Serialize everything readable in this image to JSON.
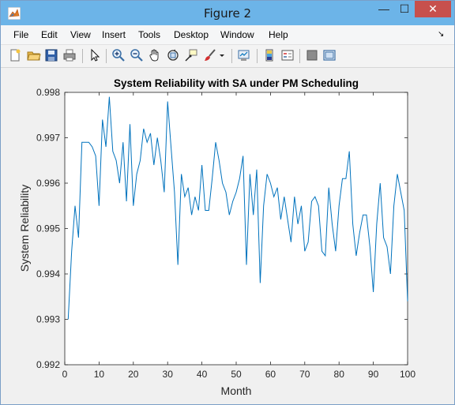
{
  "window": {
    "title": "Figure 2",
    "minimize_glyph": "—",
    "maximize_glyph": "☐",
    "close_glyph": "✕"
  },
  "menu": {
    "items": [
      "File",
      "Edit",
      "View",
      "Insert",
      "Tools",
      "Desktop",
      "Window",
      "Help"
    ]
  },
  "toolbar": {
    "icons": [
      "new-figure-icon",
      "open-file-icon",
      "save-icon",
      "print-icon",
      "edit-plot-arrow-icon",
      "zoom-in-icon",
      "zoom-out-icon",
      "pan-hand-icon",
      "rotate-3d-icon",
      "data-cursor-icon",
      "brush-icon",
      "brush-dropdown-icon",
      "link-plot-icon",
      "insert-colorbar-icon",
      "insert-legend-icon",
      "hide-plot-tools-icon",
      "show-plot-tools-icon"
    ]
  },
  "colors": {
    "line": "#0072bd",
    "close_button": "#c7504d",
    "titlebar": "#6cb4e8"
  },
  "chart_data": {
    "type": "line",
    "title": "System Reliability with SA under PM Scheduling",
    "xlabel": "Month",
    "ylabel": "System Reliability",
    "xlim": [
      0,
      100
    ],
    "ylim": [
      0.992,
      0.998
    ],
    "xticks": [
      0,
      10,
      20,
      30,
      40,
      50,
      60,
      70,
      80,
      90,
      100
    ],
    "yticks": [
      0.992,
      0.993,
      0.994,
      0.995,
      0.996,
      0.997,
      0.998
    ],
    "ytick_labels": [
      "0.992",
      "0.993",
      "0.994",
      "0.995",
      "0.996",
      "0.997",
      "0.998"
    ],
    "grid": false,
    "series": [
      {
        "x": [
          1,
          2,
          3,
          4,
          5,
          6,
          7,
          8,
          9,
          10,
          11,
          12,
          13,
          14,
          15,
          16,
          17,
          18,
          19,
          20,
          21,
          22,
          23,
          24,
          25,
          26,
          27,
          28,
          29,
          30,
          31,
          32,
          33,
          34,
          35,
          36,
          37,
          38,
          39,
          40,
          41,
          42,
          43,
          44,
          45,
          46,
          47,
          48,
          49,
          50,
          51,
          52,
          53,
          54,
          55,
          56,
          57,
          58,
          59,
          60,
          61,
          62,
          63,
          64,
          65,
          66,
          67,
          68,
          69,
          70,
          71,
          72,
          73,
          74,
          75,
          76,
          77,
          78,
          79,
          80,
          81,
          82,
          83,
          84,
          85,
          86,
          87,
          88,
          89,
          90,
          91,
          92,
          93,
          94,
          95,
          96,
          97,
          98,
          99,
          100
        ],
        "y": [
          0.993,
          0.9945,
          0.9955,
          0.9948,
          0.9969,
          0.9969,
          0.9969,
          0.9968,
          0.9966,
          0.9955,
          0.9974,
          0.9968,
          0.9979,
          0.9967,
          0.9965,
          0.996,
          0.9969,
          0.9956,
          0.9973,
          0.9955,
          0.9962,
          0.9965,
          0.9972,
          0.9969,
          0.9971,
          0.9964,
          0.997,
          0.9965,
          0.9958,
          0.9978,
          0.9968,
          0.9958,
          0.9942,
          0.9962,
          0.9957,
          0.9959,
          0.9953,
          0.9957,
          0.9954,
          0.9964,
          0.9954,
          0.9954,
          0.9961,
          0.9969,
          0.9965,
          0.996,
          0.9958,
          0.9953,
          0.9956,
          0.9958,
          0.9961,
          0.9966,
          0.9942,
          0.9962,
          0.9953,
          0.9963,
          0.9938,
          0.9955,
          0.9962,
          0.996,
          0.9957,
          0.9959,
          0.9952,
          0.9957,
          0.9952,
          0.9947,
          0.9957,
          0.9951,
          0.9955,
          0.9945,
          0.9947,
          0.9956,
          0.9957,
          0.9955,
          0.9945,
          0.9944,
          0.9959,
          0.9951,
          0.9945,
          0.9955,
          0.9961,
          0.9961,
          0.9967,
          0.9951,
          0.9944,
          0.9949,
          0.9953,
          0.9953,
          0.9946,
          0.9936,
          0.9951,
          0.996,
          0.9948,
          0.9946,
          0.994,
          0.9955,
          0.9962,
          0.9958,
          0.9954,
          0.9934
        ]
      }
    ]
  }
}
